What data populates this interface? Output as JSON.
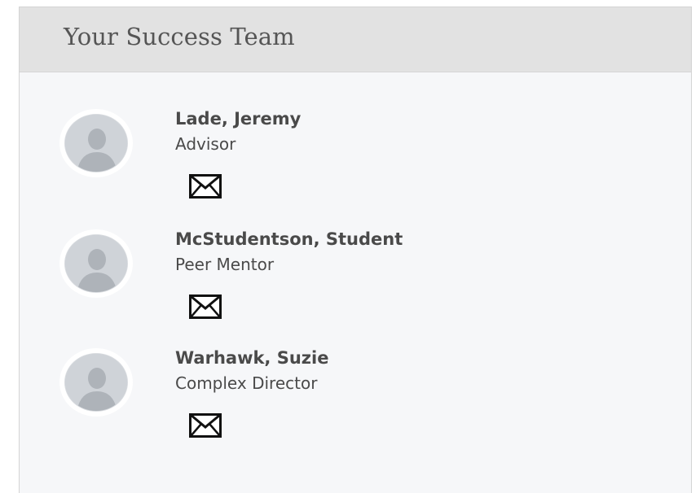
{
  "panel": {
    "title": "Your Success Team"
  },
  "team": [
    {
      "name": "Lade, Jeremy",
      "role": "Advisor",
      "icon": "mail-icon"
    },
    {
      "name": "McStudentson, Student",
      "role": "Peer Mentor",
      "icon": "mail-icon"
    },
    {
      "name": "Warhawk, Suzie",
      "role": "Complex Director",
      "icon": "mail-icon"
    }
  ],
  "colors": {
    "header_bg": "#e2e2e2",
    "panel_bg": "#f6f7f9",
    "text": "#4a4a4a",
    "title": "#555555"
  }
}
